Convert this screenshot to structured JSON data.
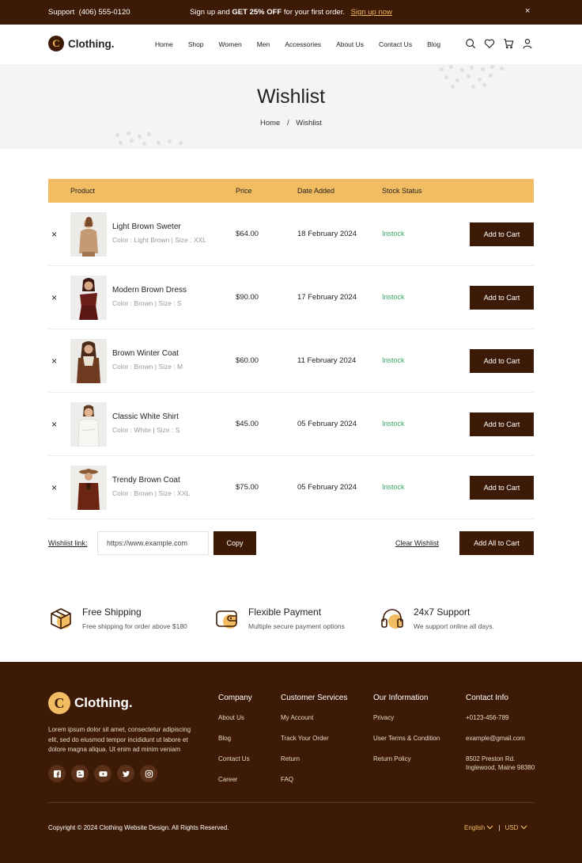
{
  "topbar": {
    "support_label": "Support",
    "support_phone": "(406) 555-0120",
    "promo_prefix": "Sign up and",
    "promo_bold": "GET 25% OFF",
    "promo_suffix": "for your first order.",
    "promo_link": "Sign up now",
    "close_glyph": "×"
  },
  "header": {
    "logo_letter": "C",
    "logo_name": "Clothing.",
    "nav": [
      "Home",
      "Shop",
      "Women",
      "Men",
      "Accessories",
      "About Us",
      "Contact Us",
      "Blog"
    ],
    "icons": [
      "search-icon",
      "heart-icon",
      "cart-icon",
      "user-icon"
    ]
  },
  "hero": {
    "title": "Wishlist",
    "breadcrumb_home": "Home",
    "breadcrumb_sep": "/",
    "breadcrumb_current": "Wishlist"
  },
  "table": {
    "headers": {
      "product": "Product",
      "price": "Price",
      "date": "Date Added",
      "stock": "Stock Status"
    },
    "rows": [
      {
        "name": "Light Brown Sweter",
        "meta": "Color : Light Brown | Size : XXL",
        "price": "$64.00",
        "date": "18 February 2024",
        "stock": "Instock",
        "action": "Add to Cart",
        "remove": "×"
      },
      {
        "name": "Modern Brown Dress",
        "meta": "Color :  Brown | Size : S",
        "price": "$90.00",
        "date": "17 February 2024",
        "stock": "Instock",
        "action": "Add to Cart",
        "remove": "×"
      },
      {
        "name": "Brown Winter Coat",
        "meta": "Color :  Brown | Size : M",
        "price": "$60.00",
        "date": "11 February 2024",
        "stock": "Instock",
        "action": "Add to Cart",
        "remove": "×"
      },
      {
        "name": "Classic White Shirt",
        "meta": "Color :  White | Size : S",
        "price": "$45.00",
        "date": "05 February 2024",
        "stock": "Instock",
        "action": "Add to Cart",
        "remove": "×"
      },
      {
        "name": "Trendy Brown Coat",
        "meta": "Color : Brown | Size : XXL",
        "price": "$75.00",
        "date": "05 February 2024",
        "stock": "Instock",
        "action": "Add to Cart",
        "remove": "×"
      }
    ]
  },
  "wishlist_actions": {
    "link_label": "Wishlist link:",
    "link_value": "https://www.example.com",
    "copy_label": "Copy",
    "clear_label": "Clear Wishlist",
    "add_all_label": "Add All to Cart"
  },
  "features": [
    {
      "icon": "box-icon",
      "title": "Free Shipping",
      "desc": "Free shipping for order above $180"
    },
    {
      "icon": "wallet-icon",
      "title": "Flexible Payment",
      "desc": "Multiple secure payment options"
    },
    {
      "icon": "headset-icon",
      "title": "24x7 Support",
      "desc": "We support online all days."
    }
  ],
  "footer": {
    "logo_letter": "C",
    "logo_name": "Clothing.",
    "description": "Lorem ipsum dolor sit amet, consectetur adipiscing elit, sed do eiusmod tempor incididunt ut labore et dolore magna aliqua. Ut enim ad minim veniam",
    "social": [
      "facebook-icon",
      "blogger-icon",
      "youtube-icon",
      "twitter-icon",
      "instagram-icon"
    ],
    "columns": [
      {
        "heading": "Company",
        "links": [
          "About Us",
          "Blog",
          "Contact Us",
          "Career"
        ]
      },
      {
        "heading": "Customer Services",
        "links": [
          "My Account",
          "Track Your Order",
          "Return",
          "FAQ"
        ]
      },
      {
        "heading": "Our Information",
        "links": [
          "Privacy",
          "User Terms & Condition",
          "Return Policy"
        ]
      },
      {
        "heading": "Contact Info",
        "links": [
          "+0123-456-789",
          "example@gmail.com",
          "8502 Preston Rd. Inglewood, Maine 98380"
        ]
      }
    ],
    "copyright": "Copyright © 2024 Clothing Website Design. All Rights Reserved.",
    "language": "English",
    "currency": "USD",
    "locale_sep": "|"
  },
  "colors": {
    "brand_dark": "#3d1a06",
    "accent": "#f2bd62",
    "instock": "#3aaa6a"
  }
}
